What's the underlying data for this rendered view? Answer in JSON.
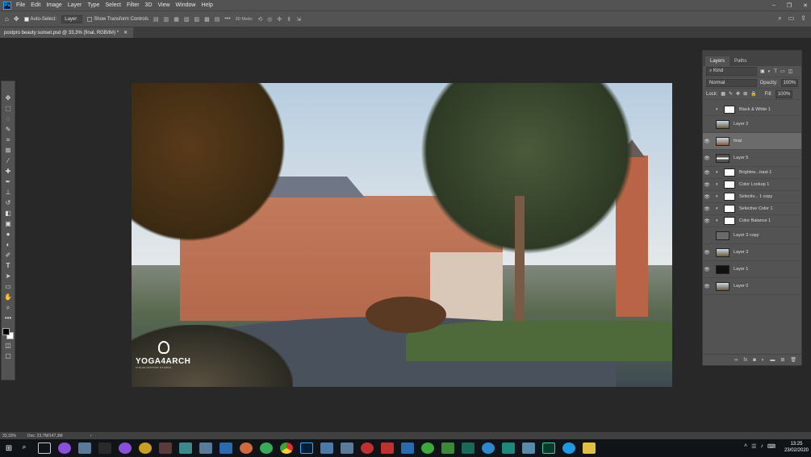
{
  "menubar": {
    "app_icon": "Ps",
    "items": [
      "File",
      "Edit",
      "Image",
      "Layer",
      "Type",
      "Select",
      "Filter",
      "3D",
      "View",
      "Window",
      "Help"
    ],
    "window_controls": [
      "minimize-icon",
      "restore-icon",
      "close-icon"
    ]
  },
  "options": {
    "auto_select_label": "Auto-Select:",
    "auto_select_value": "Layer",
    "show_transform_label": "Show Transform Controls",
    "mode_3d_label": "3D Mode:"
  },
  "document": {
    "tab_title": "postpro beauty sunset.psd @ 33,3% (final, RGB/8#) *",
    "watermark_brand": "YOGA4ARCH",
    "watermark_sub": "VISUALIZATION STUDIO"
  },
  "layers_panel": {
    "tabs": [
      "Layers",
      "Paths"
    ],
    "kind_label": "Kind",
    "blend_mode": "Normal",
    "opacity_label": "Opacity:",
    "opacity_value": "100%",
    "lock_label": "Lock:",
    "fill_label": "Fill:",
    "fill_value": "100%",
    "layers": [
      {
        "name": "Black & White 1",
        "visible": false,
        "type": "adjustment"
      },
      {
        "name": "Layer 2",
        "visible": false,
        "type": "image"
      },
      {
        "name": "final",
        "visible": true,
        "type": "image",
        "selected": true
      },
      {
        "name": "Layer 5",
        "visible": true,
        "type": "image"
      },
      {
        "name": "Brightne...trast 1",
        "visible": true,
        "type": "adjustment"
      },
      {
        "name": "Color Lookup 1",
        "visible": true,
        "type": "adjustment"
      },
      {
        "name": "Selectiv... 1 copy",
        "visible": true,
        "type": "adjustment"
      },
      {
        "name": "Selective Color 1",
        "visible": true,
        "type": "adjustment"
      },
      {
        "name": "Color Balance 1",
        "visible": true,
        "type": "adjustment"
      },
      {
        "name": "Layer 3 copy",
        "visible": false,
        "type": "image"
      },
      {
        "name": "Layer 3",
        "visible": true,
        "type": "image"
      },
      {
        "name": "Layer 1",
        "visible": true,
        "type": "image"
      },
      {
        "name": "Layer 0",
        "visible": true,
        "type": "image"
      }
    ]
  },
  "status": {
    "zoom": "33,33%",
    "doc_size": "Doc: 23,7M/147,3M"
  },
  "taskbar": {
    "time": "13:25",
    "date": "23/02/2020"
  },
  "colors": {
    "ui_dark": "#535353",
    "canvas_bg": "#282828",
    "ps_blue": "#31a8ff"
  }
}
